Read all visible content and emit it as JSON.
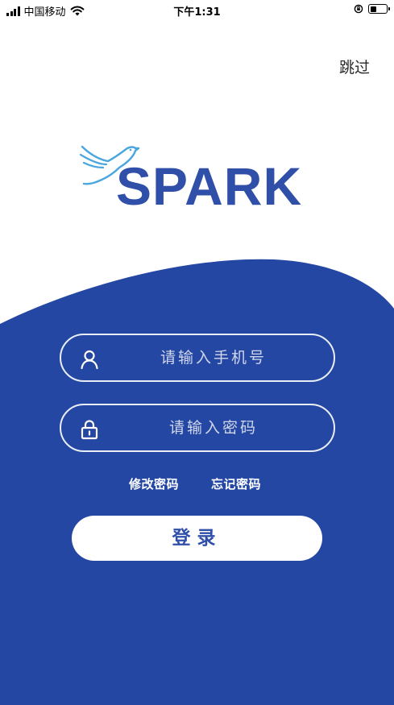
{
  "status_bar": {
    "carrier": "中国移动",
    "time": "下午1:31"
  },
  "header": {
    "skip_label": "跳过"
  },
  "logo": {
    "brand_text": "SPARK"
  },
  "form": {
    "phone_placeholder": "请输入手机号",
    "password_placeholder": "请输入密码",
    "change_password_label": "修改密码",
    "forgot_password_label": "忘记密码",
    "login_label": "登录"
  },
  "icons": {
    "phone_field": "user-icon",
    "password_field": "lock-icon",
    "logo_mark": "dove-icon"
  },
  "colors": {
    "primary": "#2447a3",
    "brand_text": "#2f4fa8",
    "dove_line": "#4aa6de",
    "background": "#ffffff"
  }
}
